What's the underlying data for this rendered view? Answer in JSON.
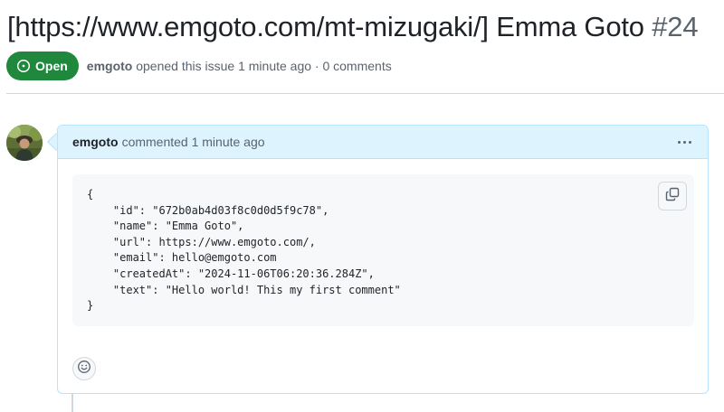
{
  "issue": {
    "title": "[https://www.emgoto.com/mt-mizugaki/] Emma Goto",
    "number": "#24",
    "state": "Open",
    "author": "emgoto",
    "opened_text": "opened this issue 1 minute ago · 0 comments"
  },
  "comment": {
    "author": "emgoto",
    "meta": "commented 1 minute ago",
    "code_lines": [
      "{",
      "    \"id\": \"672b0ab4d03f8c0d0d5f9c78\",",
      "    \"name\": \"Emma Goto\",",
      "    \"url\": https://www.emgoto.com/,",
      "    \"email\": hello@emgoto.com",
      "    \"createdAt\": \"2024-11-06T06:20:36.284Z\",",
      "    \"text\": \"Hello world! This my first comment\"",
      "}"
    ]
  },
  "icons": {
    "state": "issue-opened-icon",
    "menu": "kebab-horizontal-icon",
    "copy": "copy-icon",
    "reaction": "smiley-icon"
  },
  "colors": {
    "open_green": "#1f883d",
    "header_blue": "#ddf4ff",
    "border_blue": "#b6e3ff",
    "muted": "#59636e"
  }
}
